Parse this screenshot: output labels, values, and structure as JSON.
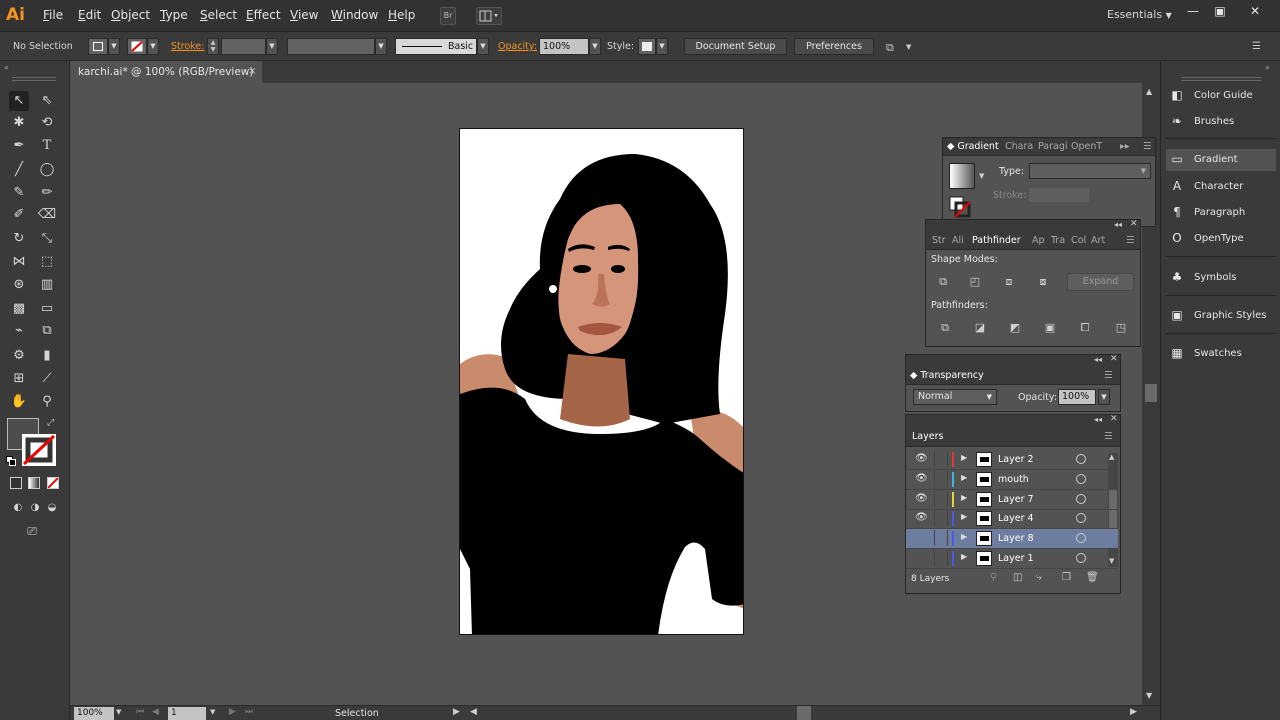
{
  "app": {
    "logo": "Ai",
    "menus": [
      "File",
      "Edit",
      "Object",
      "Type",
      "Select",
      "Effect",
      "View",
      "Window",
      "Help"
    ],
    "bridge_icon": "Br",
    "workspace": "Essentials",
    "window_min": "—",
    "window_max": "▣",
    "window_close": "✕"
  },
  "control_bar": {
    "selection": "No Selection",
    "stroke_label": "Stroke:",
    "brush_label": "Basic",
    "opacity_label": "Opacity:",
    "opacity_value": "100%",
    "style_label": "Style:",
    "document_setup": "Document Setup",
    "preferences": "Preferences"
  },
  "document": {
    "tab_title": "karchi.ai* @ 100% (RGB/Preview)",
    "close": "×"
  },
  "dock": {
    "items": [
      {
        "label": "Color Guide",
        "icon": "color-guide-icon",
        "glyph": "◧"
      },
      {
        "label": "Brushes",
        "icon": "brushes-icon",
        "glyph": "❧"
      },
      {
        "label": "Gradient",
        "icon": "gradient-icon",
        "glyph": "▭"
      },
      {
        "label": "Character",
        "icon": "character-icon",
        "glyph": "A"
      },
      {
        "label": "Paragraph",
        "icon": "paragraph-icon",
        "glyph": "¶"
      },
      {
        "label": "OpenType",
        "icon": "opentype-icon",
        "glyph": "O"
      },
      {
        "label": "Symbols",
        "icon": "symbols-icon",
        "glyph": "♣"
      },
      {
        "label": "Graphic Styles",
        "icon": "graphic-styles-icon",
        "glyph": "▣"
      },
      {
        "label": "Swatches",
        "icon": "swatches-icon",
        "glyph": "▦"
      }
    ]
  },
  "gradient_panel": {
    "tabs": [
      "Gradient",
      "Chara",
      "Paragi",
      "OpenT"
    ],
    "type_label": "Type:",
    "stroke_label": "Stroke:"
  },
  "pathfinder_panel": {
    "tabs": [
      "Str",
      "Ali",
      "Pathfinder",
      "Ap",
      "Tra",
      "Col",
      "Art"
    ],
    "shape_modes": "Shape Modes:",
    "expand": "Expand",
    "pathfinders": "Pathfinders:"
  },
  "transparency_panel": {
    "title": "Transparency",
    "blend_mode": "Normal",
    "opacity_label": "Opacity:",
    "opacity_value": "100%"
  },
  "layers_panel": {
    "title": "Layers",
    "layers": [
      {
        "name": "Layer 2",
        "color": "#e23b3b",
        "visible": true,
        "selected": false
      },
      {
        "name": "mouth",
        "color": "#3bb8e2",
        "visible": true,
        "selected": false
      },
      {
        "name": "Layer 7",
        "color": "#e2d63b",
        "visible": true,
        "selected": false
      },
      {
        "name": "Layer 4",
        "color": "#4a5ae2",
        "visible": true,
        "selected": false
      },
      {
        "name": "Layer 8",
        "color": "#4a5ae2",
        "visible": false,
        "selected": true
      },
      {
        "name": "Layer 1",
        "color": "#4a5ae2",
        "visible": false,
        "selected": false
      }
    ],
    "count": "8 Layers"
  },
  "status_bar": {
    "zoom": "100%",
    "artboard": "1",
    "tool": "Selection"
  }
}
